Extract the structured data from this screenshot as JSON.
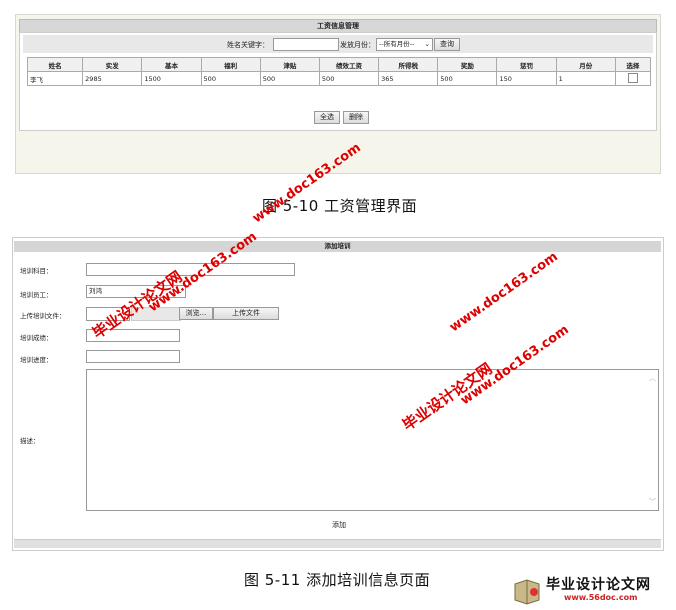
{
  "salary_panel": {
    "title": "工资信息管理",
    "search_label": "姓名关键字：",
    "search_value": "",
    "month_label": "发放月份：",
    "month_selected": "--所有月份--",
    "query_button": "查询",
    "columns": [
      "姓名",
      "实发",
      "基本",
      "福利",
      "津贴",
      "绩效工资",
      "所得税",
      "奖励",
      "惩罚",
      "月份",
      "选择"
    ],
    "rows": [
      [
        "李飞",
        "2985",
        "1500",
        "500",
        "500",
        "500",
        "365",
        "500",
        "150",
        "1"
      ]
    ],
    "select_all_button": "全选",
    "delete_button": "删除"
  },
  "caption1": "图 5-10 工资管理界面",
  "training_form": {
    "title": "添加培训",
    "subject_label": "培训科目：",
    "employee_label": "培训员工：",
    "employee_selected": "刘鸿",
    "upload_label": "上传培训文件：",
    "browse_button": "浏览...",
    "upload_button": "上传文件",
    "score_label": "培训成绩：",
    "progress_label": "培训进度：",
    "desc_label": "描述：",
    "submit_label": "添加"
  },
  "caption2": "图 5-11 添加培训信息页面",
  "watermarks": {
    "site_text": "毕业设计论文网",
    "url_text": "www.doc163.com",
    "logo_title": "毕业设计论文网",
    "logo_url": "www.56doc.com"
  }
}
